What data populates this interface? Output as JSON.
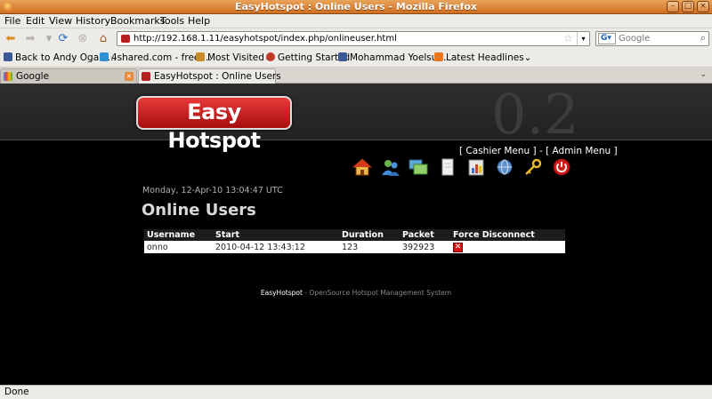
{
  "window": {
    "title": "EasyHotspot : Online Users - Mozilla Firefox"
  },
  "menu": [
    "File",
    "Edit",
    "View",
    "History",
    "Bookmarks",
    "Tools",
    "Help"
  ],
  "nav": {
    "url": "http://192.168.1.11/easyhotspot/index.php/onlineuser.html",
    "search_placeholder": "Google"
  },
  "bookmarks": [
    {
      "label": "Back to Andy Ogan'...",
      "icon": "facebook-icon",
      "color": "#3b5998"
    },
    {
      "label": "4shared.com - free ...",
      "icon": "4shared-icon",
      "color": "#2f8fd0"
    },
    {
      "label": "Most Visited",
      "icon": "folder-icon",
      "color": "#c98b2a"
    },
    {
      "label": "Getting Started",
      "icon": "firefox-icon",
      "color": "#c0392b"
    },
    {
      "label": "Mohammad Yoelsu...",
      "icon": "facebook-icon",
      "color": "#3b5998"
    },
    {
      "label": "Latest Headlines",
      "icon": "rss-icon",
      "color": "#e8771e"
    }
  ],
  "tabs": [
    {
      "label": "Google",
      "active": false
    },
    {
      "label": "EasyHotspot : Online Users",
      "active": true
    }
  ],
  "page": {
    "logo_text": "Easy Hotspot",
    "version": "0.2",
    "cashier_menu": "[ Cashier Menu ]",
    "separator": " - ",
    "admin_menu": "[ Admin Menu ]",
    "datetime": "Monday, 12-Apr-10 13:04:47 UTC",
    "title": "Online Users",
    "table": {
      "headers": [
        "Username",
        "Start",
        "Duration",
        "Packet",
        "Force Disconnect"
      ],
      "rows": [
        [
          "onno",
          "2010-04-12 13:43:12",
          "123",
          "392923"
        ]
      ]
    },
    "footer_brand": "EasyHotspot",
    "footer_text": " - OpenSource Hotspot Management System"
  },
  "status": "Done"
}
